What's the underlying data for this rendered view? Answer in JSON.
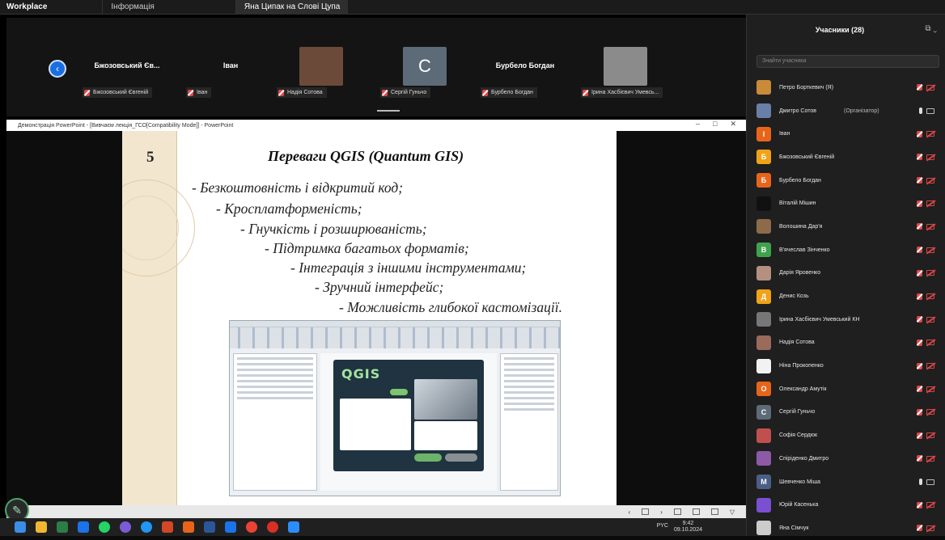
{
  "topbar": {
    "app_name": "Workplace",
    "tabs": [
      {
        "label": "Інформація"
      },
      {
        "label": "Яна Ципак на Слові Цупа"
      }
    ]
  },
  "strip": {
    "tiles": [
      {
        "name": "Бжозовський Єв...",
        "sub": "Бжозовський Євгеній",
        "has_thumb": false
      },
      {
        "name": "Іван",
        "sub": "Іван",
        "has_thumb": false
      },
      {
        "name": "",
        "sub": "Надія Сотова",
        "has_thumb": true,
        "thumb_color": "#6b4a3a"
      },
      {
        "name": "",
        "sub": "Сергій Гуньчо",
        "has_thumb": true,
        "thumb_color": "#5d6b78",
        "thumb_letter": "C"
      },
      {
        "name": "Бурбело Богдан",
        "sub": "Бурбело Богдан",
        "has_thumb": false
      },
      {
        "name": "",
        "sub": "Ірина Хасбієвич Умевсь...",
        "has_thumb": true,
        "thumb_color": "#8b8b8b"
      }
    ]
  },
  "ppt": {
    "title": "Демонстрація PowerPoint - [Вивчаєм лекція_ГСО[Compatibility Mode]] - PowerPoint",
    "slide_number": "5",
    "slide_title": "Переваги QGIS (Quantum GIS)",
    "bullets": [
      "- Безкоштовність і відкритий код;",
      "- Кросплатформеність;",
      "- Гнучкість і розширюваність;",
      "- Підтримка багатьох форматів;",
      "- Інтеграція з іншими інструментами;",
      "- Зручний інтерфейс;",
      "- Можливість глибокої кастомізації."
    ],
    "qgis_logo": "QGIS"
  },
  "taskbar": {
    "lang": "PYC",
    "time": "9:42",
    "date": "09.10.2024"
  },
  "panel": {
    "title": "Учасники (28)",
    "search_placeholder": "Знайти учасника",
    "participants": [
      {
        "name": "Петро Борткевич (Я)",
        "color": "#c98a3a",
        "letter": "",
        "cam": "off",
        "extra": ""
      },
      {
        "name": "Дмитро Сотов",
        "color": "#6a7fa8",
        "letter": "",
        "cam": "on",
        "extra": "(Організатор)"
      },
      {
        "name": "Іван",
        "color": "#e8641a",
        "letter": "І",
        "cam": "off",
        "extra": ""
      },
      {
        "name": "Бжозовський Євгеній",
        "color": "#f0a218",
        "letter": "Б",
        "cam": "off",
        "extra": ""
      },
      {
        "name": "Бурбело Богдан",
        "color": "#e8641a",
        "letter": "Б",
        "cam": "off",
        "extra": ""
      },
      {
        "name": "Віталій Мішин",
        "color": "#111111",
        "letter": "",
        "cam": "off",
        "extra": ""
      },
      {
        "name": "Волошина Дар'я",
        "color": "#8c6a4a",
        "letter": "",
        "cam": "off",
        "extra": ""
      },
      {
        "name": "В'ячеслав Зінченко",
        "color": "#3fa34d",
        "letter": "В",
        "cam": "off",
        "extra": ""
      },
      {
        "name": "Дарія Яровенко",
        "color": "#b49080",
        "letter": "",
        "cam": "off",
        "extra": ""
      },
      {
        "name": "Денис Козь",
        "color": "#f0a218",
        "letter": "Д",
        "cam": "off",
        "extra": ""
      },
      {
        "name": "Ірина Хасбієвич Умевський КН",
        "color": "#777777",
        "letter": "",
        "cam": "off",
        "extra": ""
      },
      {
        "name": "Надія Сотова",
        "color": "#9a6a5a",
        "letter": "",
        "cam": "off",
        "extra": ""
      },
      {
        "name": "Ніна Прокопенко",
        "color": "#f2f2f2",
        "letter": "",
        "cam": "off",
        "extra": ""
      },
      {
        "name": "Олександр Амутік",
        "color": "#e8641a",
        "letter": "О",
        "cam": "off",
        "extra": ""
      },
      {
        "name": "Сергій Гуньчо",
        "color": "#5d6b78",
        "letter": "С",
        "cam": "off",
        "extra": ""
      },
      {
        "name": "Софія Сердюк",
        "color": "#c0504d",
        "letter": "",
        "cam": "off",
        "extra": ""
      },
      {
        "name": "Спіріденко Дмитро",
        "color": "#8d5aa8",
        "letter": "",
        "cam": "off",
        "extra": ""
      },
      {
        "name": "Шевченко Міша",
        "color": "#4a5f86",
        "letter": "М",
        "cam": "on",
        "extra": ""
      },
      {
        "name": "Юрій Касенька",
        "color": "#7a4fd1",
        "letter": "",
        "cam": "off",
        "extra": ""
      },
      {
        "name": "Яна Сімчук",
        "color": "#cccccc",
        "letter": "",
        "cam": "off",
        "extra": ""
      }
    ]
  }
}
